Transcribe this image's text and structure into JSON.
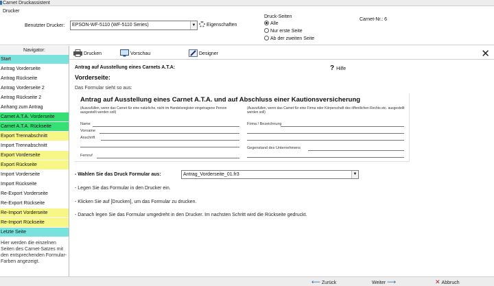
{
  "window": {
    "title": "Carnet Druckassistent"
  },
  "printer": {
    "section_label": "Drucker",
    "used_printer_label": "Benutzter Drucker:",
    "selected_printer": "EPSON-WF-5110 (WF-5110 Series)",
    "properties_label": "Eigenschaften"
  },
  "print_pages": {
    "label": "Druck-Seiten",
    "options": [
      {
        "label": "Alle",
        "selected": true
      },
      {
        "label": "Nur erste Seite",
        "selected": false
      },
      {
        "label": "Ab der zweiten Seite",
        "selected": false
      }
    ]
  },
  "carnet": {
    "label": "Carnet-Nr.: 6"
  },
  "nav": {
    "title": "Navigator:",
    "items": [
      {
        "label": "Start",
        "color": "teal"
      },
      {
        "label": "Antrag Vorderseite",
        "color": "plain"
      },
      {
        "label": "Antrag Rückseite",
        "color": "plain"
      },
      {
        "label": "Antrag Vorderseite 2",
        "color": "plain"
      },
      {
        "label": "Antrag Rückseite 2",
        "color": "plain"
      },
      {
        "label": "Anhang zum Antrag",
        "color": "plain"
      },
      {
        "label": "Carnet A.T.A. Vorderseite",
        "color": "green"
      },
      {
        "label": "Carnet A.T.A. Rückseite",
        "color": "green"
      },
      {
        "label": "Export Trennabschnitt",
        "color": "yellow"
      },
      {
        "label": "Import Trennabschnitt",
        "color": "plain"
      },
      {
        "label": "Export Vorderseite",
        "color": "yellow"
      },
      {
        "label": "Export Rückseite",
        "color": "yellow"
      },
      {
        "label": "Import Vorderseite",
        "color": "plain"
      },
      {
        "label": "Import Rückseite",
        "color": "plain"
      },
      {
        "label": "Re-Export Vorderseite",
        "color": "plain"
      },
      {
        "label": "Re-Export Rückseite",
        "color": "plain"
      },
      {
        "label": "Re-Import Vorderseite",
        "color": "yellow"
      },
      {
        "label": "Re-Import Rückseite",
        "color": "yellow"
      },
      {
        "label": "Letzte Seite",
        "color": "teal"
      }
    ],
    "help": "Hier werden die einzelnen Seiten des Carnet-Satzes mit den entsprechenden Formular-Farben angezeigt."
  },
  "toolbar": {
    "print_label": "Drucken",
    "preview_label": "Vorschau",
    "designer_label": "Designer",
    "close_label": "✕"
  },
  "main": {
    "form_heading": "Antrag auf Ausstellung eines Carnets A.T.A:",
    "help_label": "Hilfe",
    "help_glyph": "?",
    "section_title": "Vorderseite:",
    "intro": "Das Formular sieht so aus:",
    "preview": {
      "title": "Antrag auf Ausstellung eines Carnet A.T.A. und auf Abschluss einer Kautionsversicherung",
      "note_left": "(Auszufüllen, wenn das Carnet für eine natürliche, nicht im Handelsregister eingetragene Person ausgestellt werden soll)",
      "note_right": "(Auszufüllen, wenn das Carnet für eine Firma oder Körperschaft des öffentlichen Rechts etc. ausgestellt werden soll)",
      "fields_left": [
        "Name",
        "Vorname",
        "Anschrift",
        "Fernruf"
      ],
      "fields_right": [
        "Firma / Bezeichnung",
        "Gegenstand des Unternehmens"
      ]
    },
    "choose_label": "- Wahlen Sie das Druck Formular aus:",
    "selected_form": "Antrag_Vorderseite_01.fr3",
    "steps": [
      "- Legen Sie das Formular in den Drucker ein.",
      "- Klicken Sie auf [Drucken], um das Formular zu drucken.",
      "- Danach legen Sie das Formular umgedreht in den Drucker. Im nachsten Schritt wird die Rückseite gedruckt."
    ]
  },
  "footer": {
    "back_label": "Zurück",
    "next_label": "Weiter",
    "cancel_label": "Abbruch"
  }
}
